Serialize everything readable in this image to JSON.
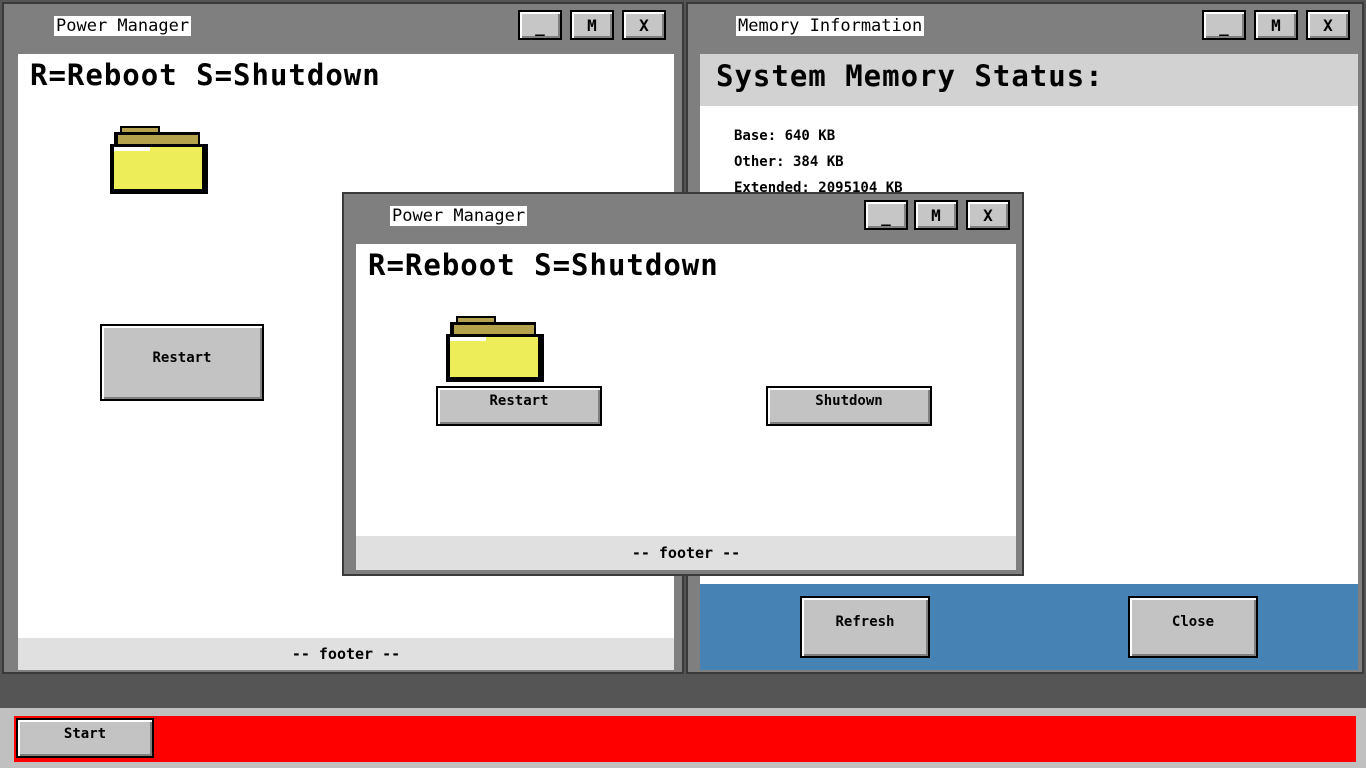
{
  "icons": {
    "folder": "folder-icon"
  },
  "colors": {
    "desktop": "#555555",
    "taskbar_strip": "#ff0000",
    "button_panel": "#4682b4",
    "folder_body": "#eded5a",
    "folder_tab": "#b5a24d"
  },
  "window_buttons": {
    "minimize": "_",
    "maximize": "M",
    "close": "X"
  },
  "power_back": {
    "title": "Power Manager",
    "heading": "R=Reboot S=Shutdown",
    "restart_label": "Restart",
    "footer": "-- footer --"
  },
  "memory": {
    "title": "Memory Information",
    "heading": "System Memory Status:",
    "lines": [
      "Base: 640 KB",
      "Other: 384 KB",
      "Extended: 2095104 KB"
    ],
    "refresh_label": "Refresh",
    "close_label": "Close"
  },
  "power_front": {
    "title": "Power Manager",
    "heading": "R=Reboot S=Shutdown",
    "restart_label": "Restart",
    "shutdown_label": "Shutdown",
    "footer": "-- footer --"
  },
  "taskbar": {
    "start_label": "Start"
  }
}
